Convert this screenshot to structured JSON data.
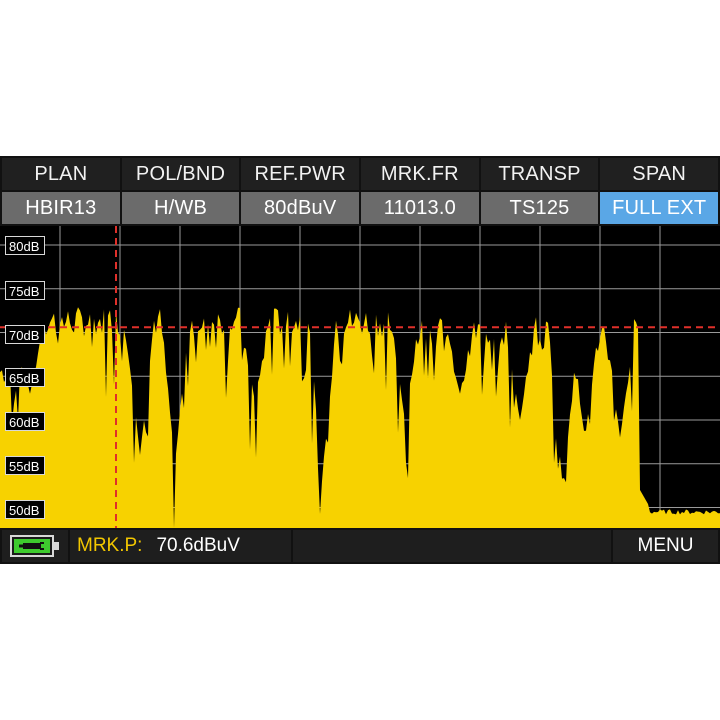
{
  "header": {
    "tabs": [
      {
        "label": "PLAN"
      },
      {
        "label": "POL/BND"
      },
      {
        "label": "REF.PWR"
      },
      {
        "label": "MRK.FR"
      },
      {
        "label": "TRANSP"
      },
      {
        "label": "SPAN"
      }
    ],
    "values": [
      {
        "label": "HBIR13"
      },
      {
        "label": "H/WB"
      },
      {
        "label": "80dBuV"
      },
      {
        "label": "11013.0"
      },
      {
        "label": "TS125"
      },
      {
        "label": "FULL EXT"
      }
    ],
    "active_value_index": 5
  },
  "spectrum": {
    "db_labels": [
      "80dB",
      "75dB",
      "70dB",
      "65dB",
      "60dB",
      "55dB",
      "50dB"
    ],
    "marker_level_db": 70.6,
    "fill_color": "#f7d200",
    "marker_color": "#e0302a",
    "grid_color": "#9a9a9a"
  },
  "status": {
    "battery_icon": "battery-charging-icon",
    "marker_label": "MRK.P:",
    "marker_value": "70.6dBuV",
    "menu_label": "MENU"
  },
  "colors": {
    "active_tab": "#5aa7e6",
    "value_bg": "#6b6b6b",
    "header_bg": "#202020",
    "marker_text": "#f2c600"
  }
}
